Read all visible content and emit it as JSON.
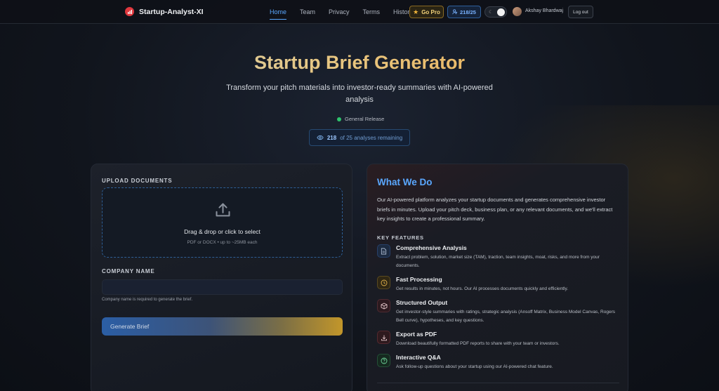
{
  "nav": {
    "brand": "Startup-Analyst-XI",
    "links": [
      "Home",
      "Team",
      "Privacy",
      "Terms",
      "History"
    ],
    "go_pro": "Go Pro",
    "usage": "218/25",
    "user_name": "Akshay Bhardwaj",
    "logout": "Log out"
  },
  "hero": {
    "title": "Startup Brief Generator",
    "subtitle": "Transform your pitch materials into investor-ready summaries with AI-powered analysis",
    "release_status": "General Release",
    "remaining_count": "218",
    "remaining_text": "of 25 analyses remaining"
  },
  "upload": {
    "label": "UPLOAD DOCUMENTS",
    "drop_text": "Drag & drop or click to select",
    "drop_hint": "PDF or DOCX • up to ~25MB each"
  },
  "company": {
    "label": "COMPANY NAME",
    "value": "",
    "hint": "Company name is required to generate the brief."
  },
  "generate_button": "Generate Brief",
  "about": {
    "title": "What We Do",
    "body": "Our AI-powered platform analyzes your startup documents and generates comprehensive investor briefs in minutes. Upload your pitch deck, business plan, or any relevant documents, and we'll extract key insights to create a professional summary.",
    "features_label": "KEY FEATURES",
    "features": [
      {
        "title": "Comprehensive Analysis",
        "desc": "Extract problem, solution, market size (TAM), traction, team insights, moat, risks, and more from your documents.",
        "icon": "document-icon",
        "color": "#5aa7ff"
      },
      {
        "title": "Fast Processing",
        "desc": "Get results in minutes, not hours. Our AI processes documents quickly and efficiently.",
        "icon": "clock-icon",
        "color": "#e0b04a"
      },
      {
        "title": "Structured Output",
        "desc": "Get investor-style summaries with ratings, strategic analysis (Ansoff Matrix, Business Model Canvas, Rogers Bell curve), hypotheses, and key questions.",
        "icon": "cube-icon",
        "color": "#e0565b"
      },
      {
        "title": "Export as PDF",
        "desc": "Download beautifully formatted PDF reports to share with your team or investors.",
        "icon": "download-icon",
        "color": "#e0565b"
      },
      {
        "title": "Interactive Q&A",
        "desc": "Ask follow-up questions about your startup using our AI-powered chat feature.",
        "icon": "help-circle-icon",
        "color": "#3fc27a"
      }
    ]
  }
}
